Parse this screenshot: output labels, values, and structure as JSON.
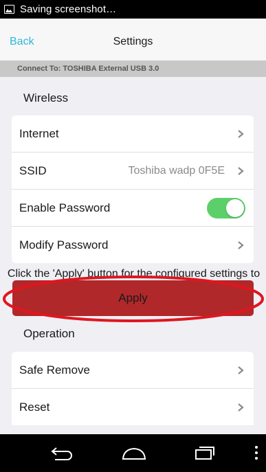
{
  "status_bar": {
    "text": "Saving screenshot…",
    "icon": "screenshot-icon"
  },
  "nav": {
    "back_label": "Back",
    "title": "Settings"
  },
  "connect_bar": {
    "text": "Connect To: TOSHIBA  External USB 3.0"
  },
  "wireless": {
    "header": "Wireless",
    "rows": [
      {
        "label": "Internet",
        "value": "",
        "control": "chevron"
      },
      {
        "label": "SSID",
        "value": "Toshiba wadp 0F5E",
        "control": "chevron"
      },
      {
        "label": "Enable Password",
        "value": "",
        "control": "toggle",
        "toggle_on": true
      },
      {
        "label": "Modify Password",
        "value": "",
        "control": "chevron"
      }
    ]
  },
  "info_text": "Click the 'Apply' button for the configured settings to take effect immediately.",
  "apply": {
    "label": "Apply",
    "color": "#b0282a",
    "highlight_color": "#e0161f"
  },
  "operation": {
    "header": "Operation",
    "rows": [
      {
        "label": "Safe Remove",
        "control": "chevron"
      },
      {
        "label": "Reset",
        "control": "chevron"
      }
    ]
  },
  "colors": {
    "accent": "#2eb7d9",
    "toggle_on": "#5bd06a",
    "background": "#efeff4"
  },
  "android_nav": {
    "icons": [
      "back-icon",
      "home-icon",
      "recents-icon",
      "menu-icon"
    ]
  }
}
